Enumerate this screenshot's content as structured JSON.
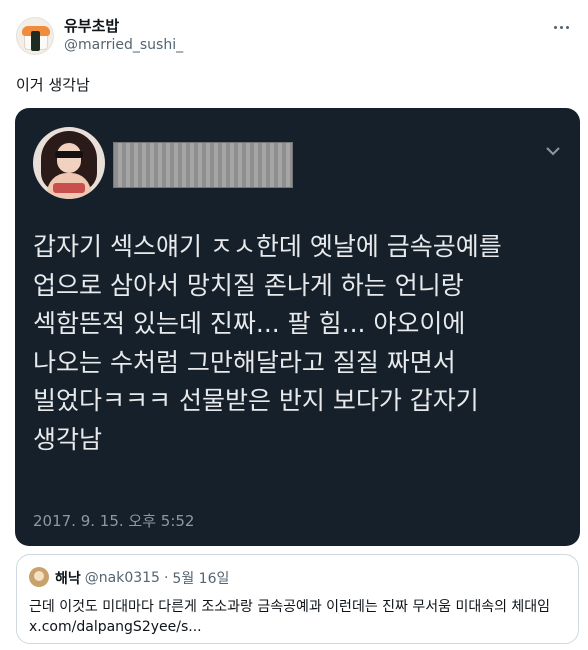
{
  "author": {
    "display_name": "유부초밥",
    "handle": "@married_sushi_",
    "avatar_icon": "sushi-avatar-icon"
  },
  "more_icon": "more-options-icon",
  "tweet": {
    "text": "이거 생각남"
  },
  "media": {
    "background": "#15202b",
    "body": "갑자기 섹스얘기 ㅈㅅ한데 옛날에 금속공예를\n업으로 삼아서 망치질 존나게 하는 언니랑\n섹함뜬적 있는데 진짜... 팔 힘... 야오이에\n나오는 수처럼 그만해달라고 질질 짜면서\n빌었다ㅋㅋㅋ 선물받은 반지 보다가 갑자기\n생각남",
    "timestamp": "2017. 9. 15. 오후 5:52",
    "chevron_icon": "chevron-down-icon"
  },
  "quote": {
    "name": "해낙",
    "handle": "@nak0315",
    "separator": "·",
    "date": "5월 16일",
    "text": "근데 이것도 미대마다 다른게 조소과랑 금속공예과 이런데는 진짜 무서움 미대속의 체대임 x.com/dalpangS2yee/s..."
  }
}
